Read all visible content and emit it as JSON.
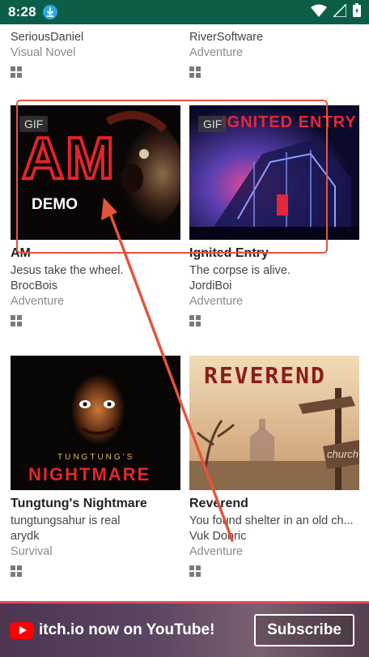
{
  "status_bar": {
    "time": "8:28"
  },
  "top_row": [
    {
      "author": "SeriousDaniel",
      "genre": "Visual Novel"
    },
    {
      "author": "RiverSoftware",
      "genre": "Adventure"
    }
  ],
  "games": [
    {
      "title": "AM",
      "description": "Jesus take the wheel.",
      "author": "BrocBois",
      "genre": "Adventure",
      "badge": "GIF",
      "art_text": "AM",
      "art_subtext": "DEMO"
    },
    {
      "title": "Ignited Entry",
      "description": "The corpse is alive.",
      "author": "JordiBoi",
      "genre": "Adventure",
      "badge": "GIF",
      "art_text": "IGNITED ENTRY"
    },
    {
      "title": "Tungtung's Nightmare",
      "description": "tungtungsahur is real",
      "author": "arydk",
      "genre": "Survival",
      "art_text_top": "TUNGTUNG'S",
      "art_text": "NIGHTMARE"
    },
    {
      "title": "Reverend",
      "description": "You found shelter in an old ch...",
      "author": "Vuk Dobric",
      "genre": "Adventure",
      "art_text": "REVEREND",
      "art_sign": "church"
    }
  ],
  "banner": {
    "text": "itch.io now on YouTube!",
    "button": "Subscribe"
  },
  "colors": {
    "status_bar": "#0d5e49",
    "annotation": "#e4553a",
    "banner_border": "#e34a5e"
  }
}
